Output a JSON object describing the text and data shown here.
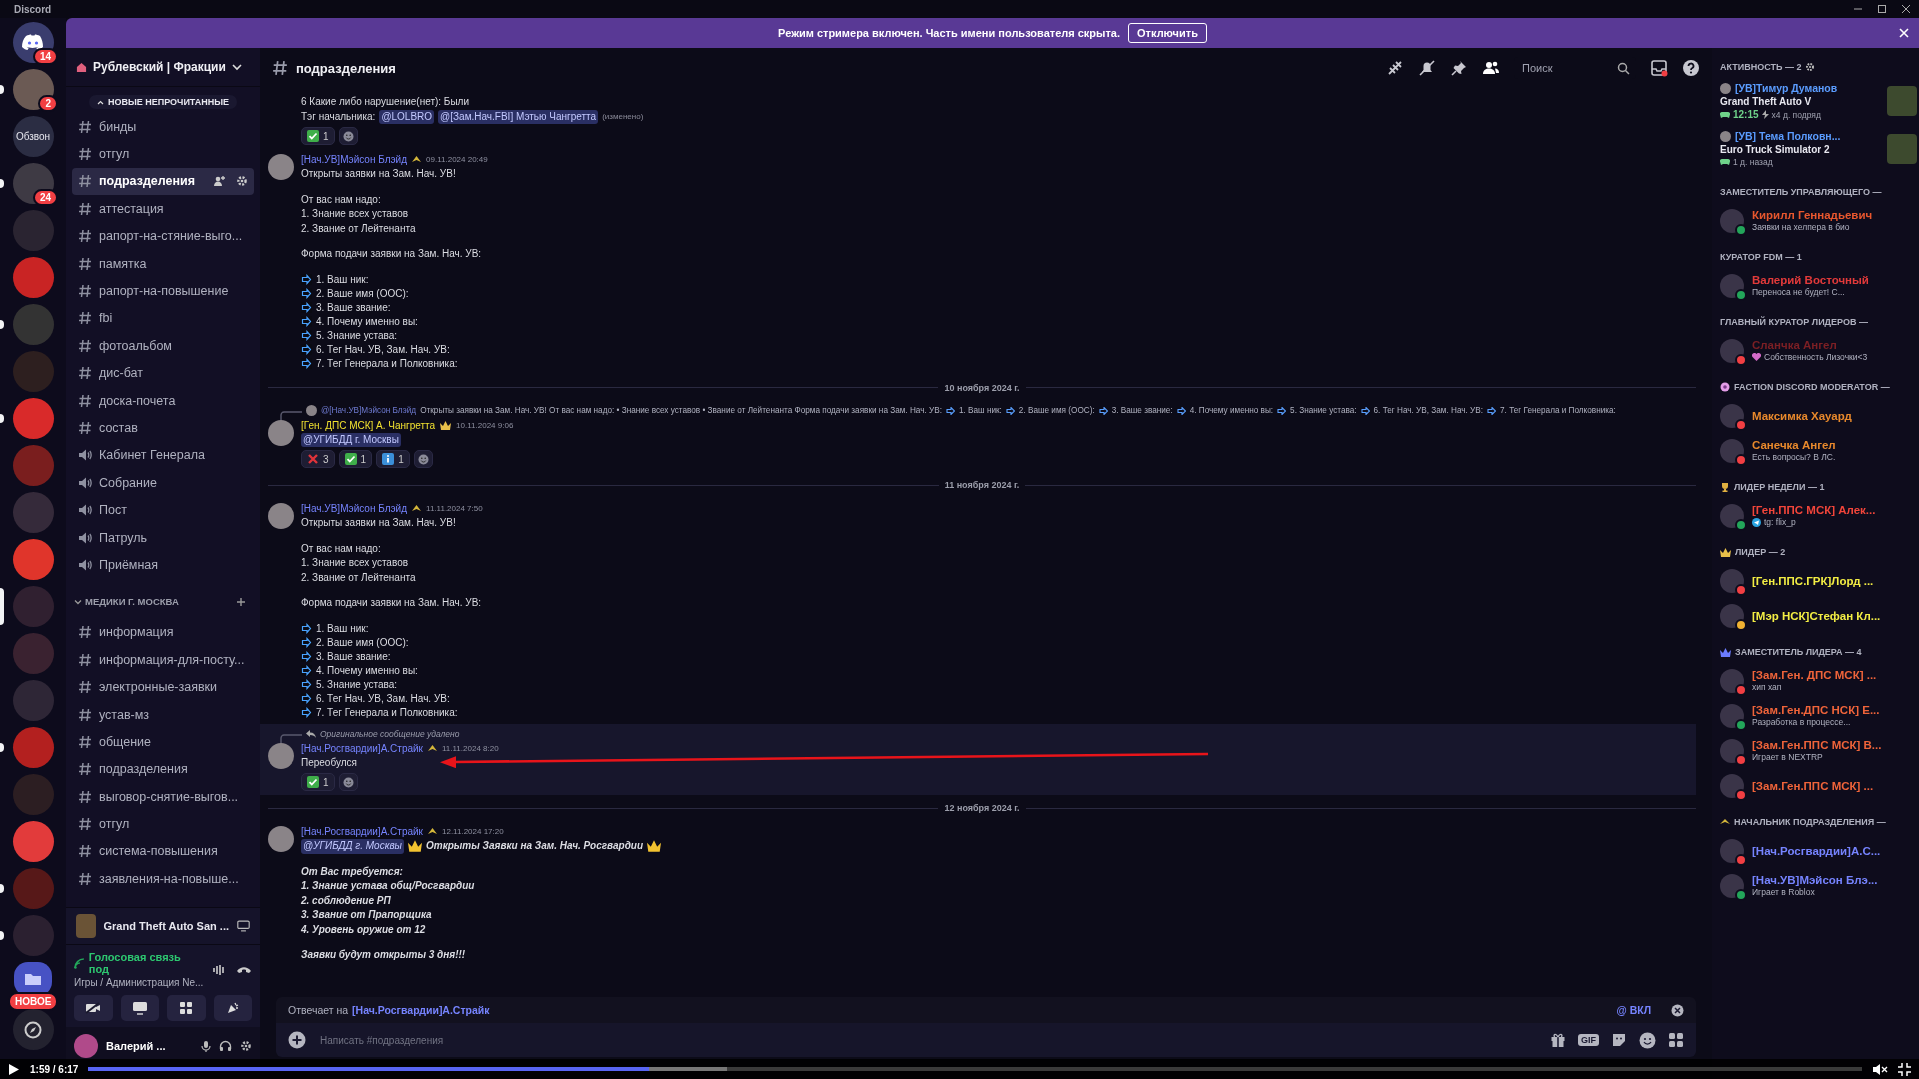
{
  "titlebar": {
    "title": "Discord"
  },
  "banner": {
    "text": "Режим стримера включен. Часть имени пользователя скрыта.",
    "button": "Отключить"
  },
  "servers": [
    {
      "kind": "home",
      "badge": "14",
      "unread": false,
      "selected": false
    },
    {
      "kind": "picture",
      "badge": "2",
      "unread": true,
      "selected": false
    },
    {
      "kind": "text",
      "label": "Обзвон",
      "unread": false,
      "selected": false
    },
    {
      "kind": "picture",
      "badge": "24",
      "unread": true,
      "selected": false
    },
    {
      "kind": "picture",
      "unread": false,
      "selected": false
    },
    {
      "kind": "picture",
      "unread": false,
      "selected": false
    },
    {
      "kind": "picture",
      "unread": true,
      "selected": false
    },
    {
      "kind": "picture",
      "unread": false,
      "selected": false
    },
    {
      "kind": "picture",
      "unread": true,
      "selected": false
    },
    {
      "kind": "picture",
      "unread": false,
      "selected": false
    },
    {
      "kind": "picture",
      "unread": false,
      "selected": false
    },
    {
      "kind": "picture",
      "unread": false,
      "selected": false
    },
    {
      "kind": "picture",
      "unread": false,
      "selected": true
    },
    {
      "kind": "picture",
      "unread": false,
      "selected": false
    },
    {
      "kind": "picture",
      "unread": false,
      "selected": false
    },
    {
      "kind": "picture",
      "unread": true,
      "selected": false
    },
    {
      "kind": "picture",
      "unread": false,
      "selected": false
    },
    {
      "kind": "picture",
      "unread": false,
      "selected": false
    },
    {
      "kind": "picture",
      "unread": true,
      "selected": false
    },
    {
      "kind": "picture",
      "unread": true,
      "selected": false
    },
    {
      "kind": "folder",
      "label": "НОВОЕ",
      "unread": false,
      "selected": false
    },
    {
      "kind": "explore",
      "unread": false,
      "selected": false
    }
  ],
  "sidebar": {
    "server_name": "Рублевский | Фракции",
    "new_unread": "НОВЫЕ НЕПРОЧИТАННЫЕ",
    "channels": [
      {
        "name": "бинды",
        "kind": "text",
        "selected": false
      },
      {
        "name": "отгул",
        "kind": "text",
        "selected": false
      },
      {
        "name": "подразделения",
        "kind": "text",
        "selected": true
      },
      {
        "name": "аттестация",
        "kind": "text",
        "selected": false
      },
      {
        "name": "рапорт-на-стяние-выго...",
        "kind": "text",
        "selected": false
      },
      {
        "name": "памятка",
        "kind": "text",
        "selected": false
      },
      {
        "name": "рапорт-на-повышение",
        "kind": "text",
        "selected": false
      },
      {
        "name": "fbi",
        "kind": "text",
        "selected": false
      },
      {
        "name": "фотоальбом",
        "kind": "text",
        "selected": false
      },
      {
        "name": "дис-бат",
        "kind": "text",
        "selected": false
      },
      {
        "name": "доска-почета",
        "kind": "text",
        "selected": false
      },
      {
        "name": "состав",
        "kind": "text",
        "selected": false
      },
      {
        "name": "Кабинет Генерала",
        "kind": "voice",
        "selected": false
      },
      {
        "name": "Собрание",
        "kind": "voice",
        "selected": false
      },
      {
        "name": "Пост",
        "kind": "voice",
        "selected": false
      },
      {
        "name": "Патруль",
        "kind": "voice",
        "selected": false
      },
      {
        "name": "Приёмная",
        "kind": "voice",
        "selected": false
      }
    ],
    "categories": [
      {
        "name": "МЕДИКИ Г. МОСКВА",
        "expanded": true,
        "channels": [
          {
            "name": "информация",
            "kind": "text",
            "selected": false
          },
          {
            "name": "информация-для-посту...",
            "kind": "text",
            "selected": false
          },
          {
            "name": "электронные-заявки",
            "kind": "text",
            "selected": false
          },
          {
            "name": "устав-мз",
            "kind": "text",
            "selected": false
          },
          {
            "name": "общение",
            "kind": "text",
            "selected": false
          },
          {
            "name": "подразделения",
            "kind": "text",
            "selected": false
          },
          {
            "name": "выговор-снятие-выгов...",
            "kind": "text",
            "selected": false
          },
          {
            "name": "отгул",
            "kind": "text",
            "selected": false
          },
          {
            "name": "система-повышения",
            "kind": "text",
            "selected": false
          },
          {
            "name": "заявления-на-повыше...",
            "kind": "text",
            "selected": false
          }
        ]
      }
    ],
    "activity": "Grand Theft Auto San ...",
    "voice": {
      "status": "Голосовая связь под",
      "location": "Игры / Администрация Ne..."
    },
    "user": {
      "name": "Валерий ..."
    }
  },
  "chat": {
    "channel": "подразделения",
    "search_placeholder": "Поиск",
    "messages": [
      {
        "kind": "continuation",
        "highlighted": false,
        "italic": false,
        "lines": [
          {
            "kind": "text",
            "text": "6 Какие либо нарушение(нет): Были"
          },
          {
            "kind": "tag",
            "text": "Тэг начальника:",
            "mentions": [
              "@LOLBRO",
              "@[Зам.Нач.FBI] Мэтью Чангретта"
            ],
            "edited": "(изменено)"
          }
        ],
        "reactions": [
          {
            "kind": "check",
            "count": "1"
          }
        ]
      },
      {
        "kind": "message",
        "highlighted": false,
        "italic": false,
        "author": "[Нач.УВ]Мэйсон Блэйд",
        "color": "#7684ff",
        "author_badge": {
          "kind": "role"
        },
        "time": "09.11.2024 20:49",
        "lines": [
          {
            "kind": "text",
            "text": "Открыты заявки на Зам. Нач. УВ!"
          },
          {
            "kind": "gap"
          },
          {
            "kind": "text",
            "text": "От вас нам надо:"
          },
          {
            "kind": "text",
            "text": "1. Знание всех уставов"
          },
          {
            "kind": "text",
            "text": "2. Звание от Лейтенанта"
          },
          {
            "kind": "gap"
          },
          {
            "kind": "text",
            "text": "Форма подачи заявки на Зам. Нач. УВ:"
          },
          {
            "kind": "gap"
          },
          {
            "kind": "arrow",
            "text": "1. Ваш ник:"
          },
          {
            "kind": "arrow",
            "text": "2. Ваше имя (OOC):"
          },
          {
            "kind": "arrow",
            "text": "3. Ваше звание:"
          },
          {
            "kind": "arrow",
            "text": "4. Почему именно вы:"
          },
          {
            "kind": "arrow",
            "text": "5. Знание устава:"
          },
          {
            "kind": "arrow",
            "text": "6. Тег Нач. УВ, Зам. Нач. УВ:"
          },
          {
            "kind": "arrow",
            "text": "7. Тег Генерала и Полковника:"
          }
        ]
      },
      {
        "kind": "divider",
        "text": "10 ноября 2024 г."
      },
      {
        "kind": "message",
        "highlighted": false,
        "italic": false,
        "reply": {
          "deleted": false,
          "author": "@[Нач.УВ]Мэйсон Блэйд",
          "segments": [
            "Открыты заявки на Зам. Нач. УВ!  От вас нам надо: • Знание всех уставов  • Звание от Лейтенанта     Форма подачи заявки на Зам. Нач. УВ:",
            "1. Ваш ник:",
            "2. Ваше имя (OOC):",
            "3. Ваше звание:",
            "4. Почему именно вы:",
            "5. Знание устава:",
            "6. Тег Нач. УВ, Зам. Нач. УВ:",
            "7. Тег Генерала и Полковника:"
          ]
        },
        "author": "[Ген. ДПС МСК] А. Чангретта",
        "color": "#f2e230",
        "author_badge": {
          "kind": "crown"
        },
        "time": "10.11.2024 9:06",
        "lines": [
          {
            "kind": "mention",
            "mention": "@УГИБДД г. Москвы"
          }
        ],
        "reactions": [
          {
            "kind": "cross",
            "count": "3"
          },
          {
            "kind": "check",
            "count": "1"
          },
          {
            "kind": "info",
            "count": "1"
          }
        ]
      },
      {
        "kind": "divider",
        "text": "11 ноября 2024 г."
      },
      {
        "kind": "message",
        "highlighted": false,
        "italic": false,
        "author": "[Нач.УВ]Мэйсон Блэйд",
        "color": "#7684ff",
        "author_badge": {
          "kind": "role"
        },
        "time": "11.11.2024 7:50",
        "lines": [
          {
            "kind": "text",
            "text": "Открыты заявки на Зам. Нач. УВ!"
          },
          {
            "kind": "gap"
          },
          {
            "kind": "text",
            "text": "От вас нам надо:"
          },
          {
            "kind": "text",
            "text": "1. Знание всех уставов"
          },
          {
            "kind": "text",
            "text": "2. Звание от Лейтенанта"
          },
          {
            "kind": "gap"
          },
          {
            "kind": "text",
            "text": "Форма подачи заявки на Зам. Нач. УВ:"
          },
          {
            "kind": "gap"
          },
          {
            "kind": "arrow",
            "text": "1. Ваш ник:"
          },
          {
            "kind": "arrow",
            "text": "2. Ваше имя (OOC):"
          },
          {
            "kind": "arrow",
            "text": "3. Ваше звание:"
          },
          {
            "kind": "arrow",
            "text": "4. Почему именно вы:"
          },
          {
            "kind": "arrow",
            "text": "5. Знание устава:"
          },
          {
            "kind": "arrow",
            "text": "6. Тег Нач. УВ, Зам. Нач. УВ:"
          },
          {
            "kind": "arrow",
            "text": "7. Тег Генерала и Полковника:"
          }
        ]
      },
      {
        "kind": "message",
        "highlighted": true,
        "italic": false,
        "annotated": true,
        "reply": {
          "deleted": true,
          "text": "Оригинальное сообщение удалено"
        },
        "author": "[Нач.Росгвардии]А.Страйк",
        "color": "#7684ff",
        "author_badge": {
          "kind": "role"
        },
        "time": "11.11.2024 8:20",
        "lines": [
          {
            "kind": "text",
            "text": "Переобулся"
          }
        ],
        "reactions": [
          {
            "kind": "check",
            "count": "1"
          }
        ]
      },
      {
        "kind": "divider",
        "text": "12 ноября 2024 г."
      },
      {
        "kind": "message",
        "highlighted": false,
        "italic": true,
        "author": "[Нач.Росгвардии]А.Страйк",
        "color": "#7684ff",
        "author_badge": {
          "kind": "role"
        },
        "time": "12.11.2024 17:20",
        "lines": [
          {
            "kind": "announcement",
            "mention": "@УГИБДД г. Москвы",
            "text": "Открыты Заявки на Зам. Нач. Росгвардии"
          },
          {
            "kind": "gap"
          },
          {
            "kind": "text",
            "text": "От Вас требуется:"
          },
          {
            "kind": "text",
            "text": "1. Знание устава общ/Росгвардии"
          },
          {
            "kind": "text",
            "text": "2. соблюдение РП"
          },
          {
            "kind": "text",
            "text": "3. Звание от Прапорщика"
          },
          {
            "kind": "text",
            "text": "4. Уровень оружие от 12"
          },
          {
            "kind": "gap"
          },
          {
            "kind": "text",
            "text": "Заявки будут открыты 3 дня!!!"
          }
        ]
      }
    ],
    "reply_bar": {
      "text": "Отвечает на",
      "target": "[Нач.Росгвардии]А.Страйк",
      "ping": "@ ВКЛ"
    },
    "composer": {
      "placeholder": "Написать #подразделения",
      "gif": "GIF"
    }
  },
  "members": {
    "groups": [
      {
        "title": "АКТИВНОСТЬ — 2",
        "badge": {
          "kind": "gear"
        },
        "members": [
          {
            "kind": "activity",
            "name": "[УВ]Тимур Думанов",
            "color": "#5b9dff",
            "game": "Grand Theft Auto V",
            "details": [
              {
                "kind": "gamepad",
                "text": "12:15",
                "highlight": true
              },
              {
                "kind": "bolt",
                "text": "x4 д. подряд",
                "highlight": false
              }
            ]
          },
          {
            "kind": "activity",
            "name": "[УВ] Тема Полковн...",
            "color": "#5b9dff",
            "game": "Euro Truck Simulator 2",
            "details": [
              {
                "kind": "gamepad",
                "text": "1 д. назад",
                "highlight": false
              }
            ]
          }
        ]
      },
      {
        "title": "ЗАМЕСТИТЕЛЬ УПРАВЛЯЮЩЕГО —",
        "members": [
          {
            "kind": "member",
            "name": "Кирилл Геннадьевич",
            "color": "#e8572e",
            "status": {
              "kind": "online"
            },
            "sub": "Заявки на хелпера в био"
          }
        ]
      },
      {
        "title": "КУРАТОР FDM — 1",
        "members": [
          {
            "kind": "member",
            "name": "Валерий Восточный",
            "color": "#e23a3a",
            "status": {
              "kind": "online"
            },
            "sub": "Переноса не будет! С..."
          }
        ]
      },
      {
        "title": "ГЛАВНЫЙ КУРАТОР ЛИДЕРОВ —",
        "members": [
          {
            "kind": "member",
            "name": "Сланчка Ангел",
            "color": "#7c1f24",
            "status": {
              "kind": "dnd"
            },
            "sub": "Собственность Лизочки<3",
            "sub_badge": {
              "kind": "heart"
            }
          }
        ]
      },
      {
        "title": "FACTION DISCORD MODERATOR —",
        "badge": {
          "kind": "shield"
        },
        "members": [
          {
            "kind": "member",
            "name": "Максимка Хауард",
            "color": "#e8892c",
            "status": {
              "kind": "dnd"
            }
          },
          {
            "kind": "member",
            "name": "Санечка Ангел",
            "color": "#e8892c",
            "status": {
              "kind": "dnd"
            },
            "sub": "Есть вопросы? В ЛС."
          }
        ]
      },
      {
        "title": "ЛИДЕР НЕДЕЛИ — 1",
        "badge": {
          "kind": "trophy"
        },
        "members": [
          {
            "kind": "member",
            "name": "[Ген.ППС МСК] Алек...",
            "color": "#f2453a",
            "status": {
              "kind": "online"
            },
            "sub": "tg: flix_p",
            "sub_badge": {
              "kind": "telegram"
            }
          }
        ]
      },
      {
        "title": "ЛИДЕР — 2",
        "badge": {
          "kind": "crown"
        },
        "members": [
          {
            "kind": "member",
            "name": "[Ген.ППС.ГРК]Лорд ...",
            "color": "#f3ee44",
            "status": {
              "kind": "dnd"
            }
          },
          {
            "kind": "member",
            "name": "[Мэр НСК]Стефан Кл...",
            "color": "#f3ee44",
            "status": {
              "kind": "idle"
            }
          }
        ]
      },
      {
        "title": "ЗАМЕСТИТЕЛЬ ЛИДЕРА — 4",
        "badge": {
          "kind": "crown"
        },
        "members": [
          {
            "kind": "member",
            "name": "[Зам.Ген. ДПС МСК] ...",
            "color": "#f0643a",
            "status": {
              "kind": "dnd"
            },
            "sub": "хип хап"
          },
          {
            "kind": "member",
            "name": "[Зам.Ген.ДПС НСК] Е...",
            "color": "#f0643a",
            "status": {
              "kind": "online"
            },
            "sub": "Разработка в процессе..."
          },
          {
            "kind": "member",
            "name": "[Зам.Ген.ППС МСК] В...",
            "color": "#f0643a",
            "status": {
              "kind": "dnd"
            },
            "sub": "Играет в NEXTRP"
          },
          {
            "kind": "member",
            "name": "[Зам.Ген.ППС МСК] ...",
            "color": "#f0643a",
            "status": {
              "kind": "dnd"
            }
          }
        ]
      },
      {
        "title": "НАЧАЛЬНИК ПОДРАЗДЕЛЕНИЯ —",
        "badge": {
          "kind": "chevron"
        },
        "members": [
          {
            "kind": "member",
            "name": "[Нач.Росгвардии]А.С...",
            "color": "#7684ff",
            "status": {
              "kind": "dnd"
            }
          },
          {
            "kind": "member",
            "name": "[Нач.УВ]Мэйсон Блэ...",
            "color": "#7684ff",
            "status": {
              "kind": "online"
            },
            "sub": "Играет в Roblox"
          }
        ]
      }
    ]
  },
  "player": {
    "time": "1:59 / 6:17",
    "level": 0.316
  }
}
